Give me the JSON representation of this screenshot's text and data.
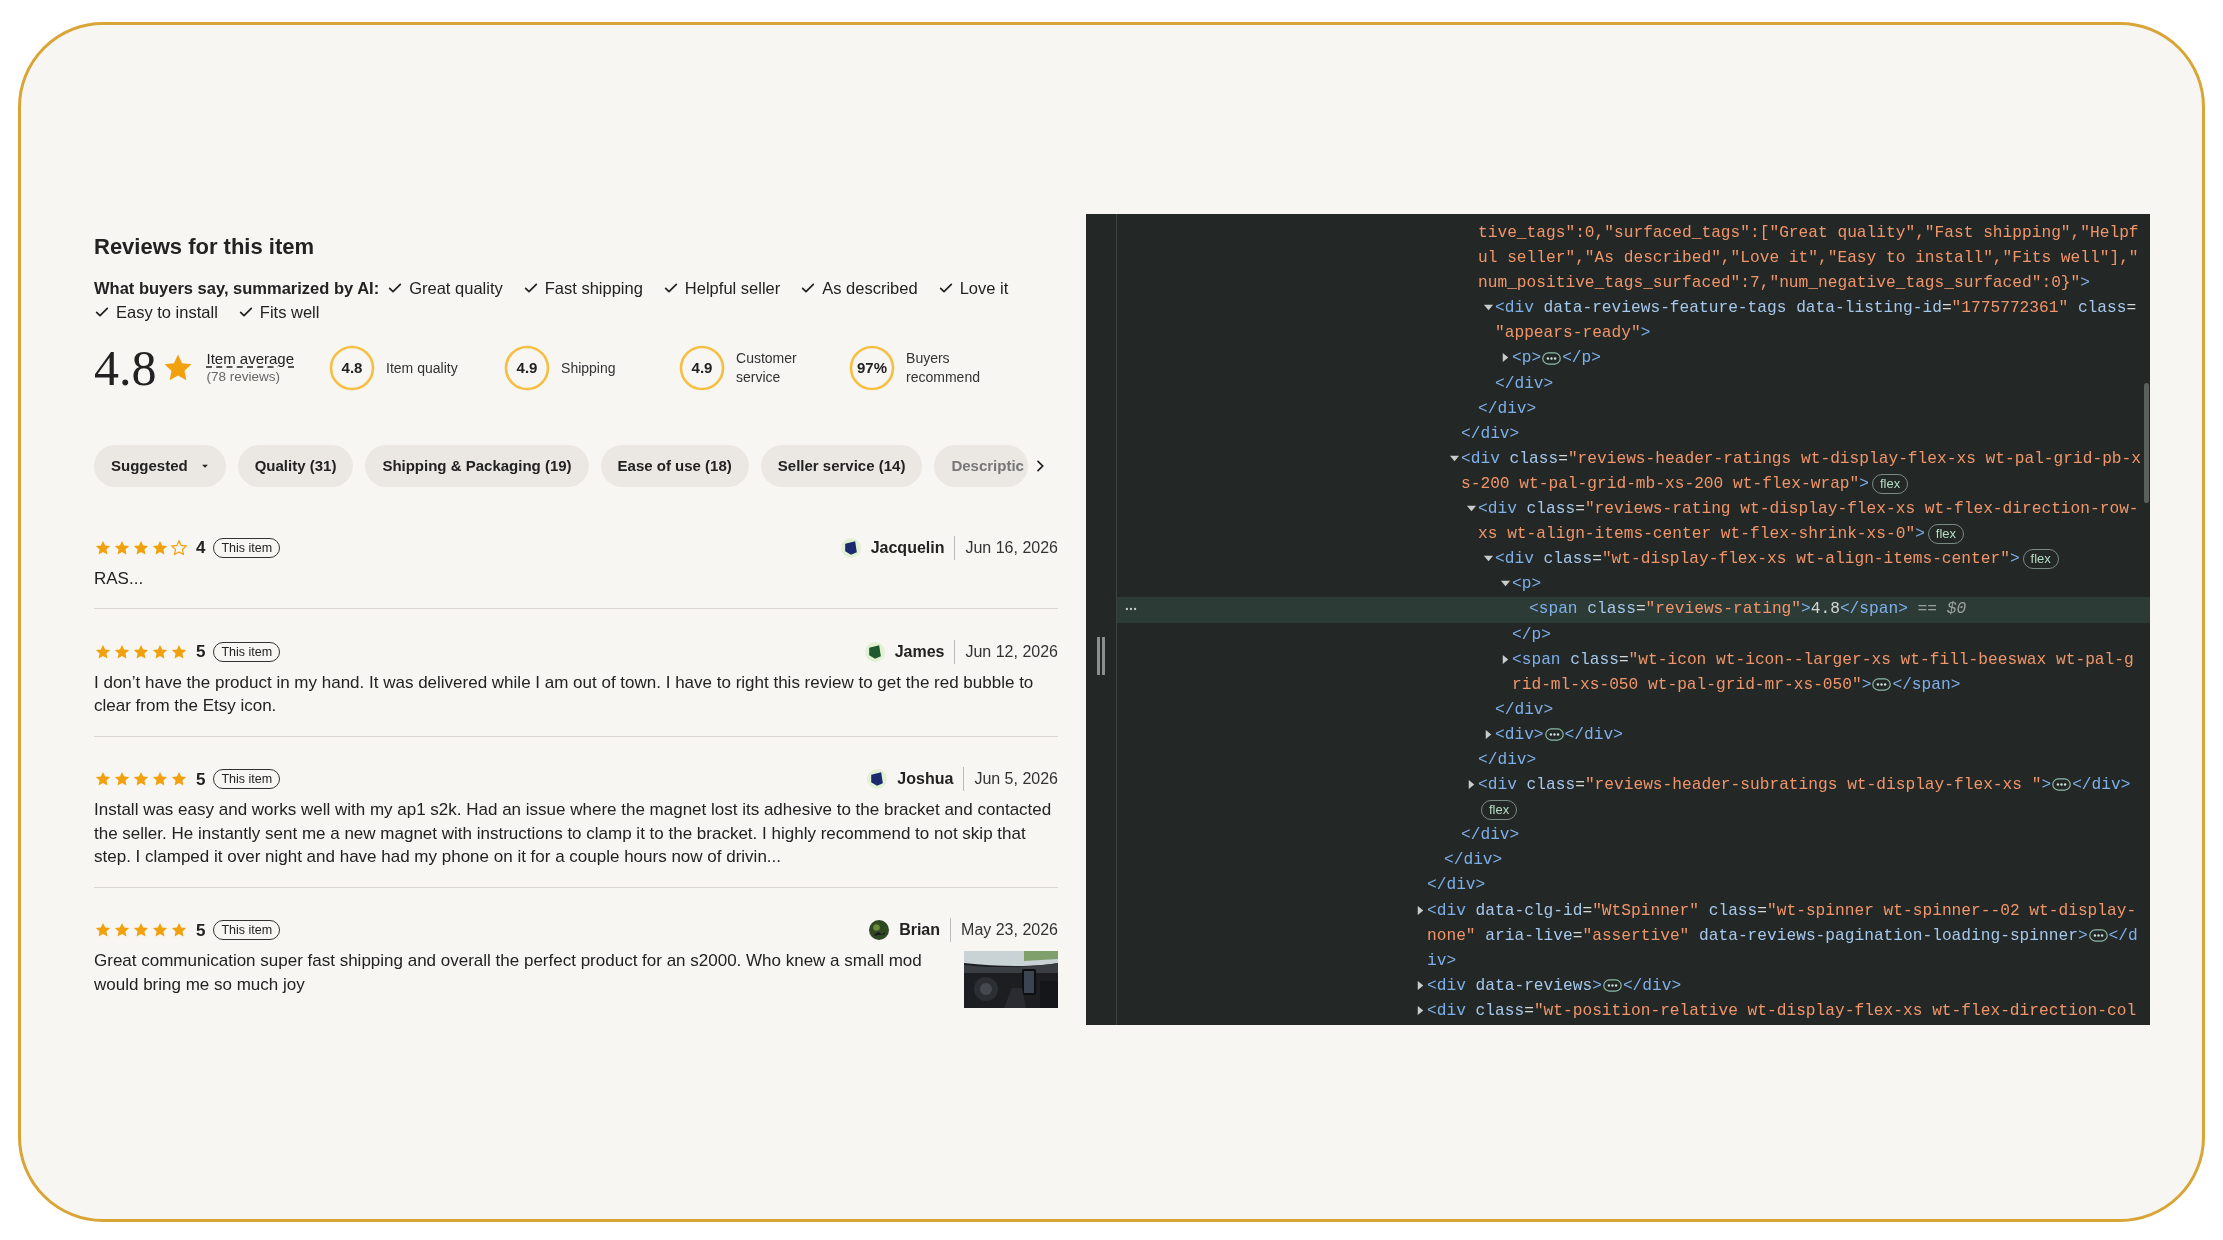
{
  "reviews_panel": {
    "title": "Reviews for this item",
    "ai_summary": {
      "label": "What buyers say, summarized by AI:",
      "tags": [
        "Great quality",
        "Fast shipping",
        "Helpful seller",
        "As described",
        "Love it",
        "Easy to install",
        "Fits well"
      ]
    },
    "rating": {
      "value": "4.8",
      "average_label": "Item average",
      "count": "(78 reviews)"
    },
    "subratings": [
      {
        "value": "4.8",
        "label": "Item quality"
      },
      {
        "value": "4.9",
        "label": "Shipping"
      },
      {
        "value": "4.9",
        "label": "Customer service"
      },
      {
        "value": "97%",
        "label": "Buyers recommend"
      }
    ],
    "filters": [
      {
        "label": "Suggested",
        "kind": "dropdown"
      },
      {
        "label": "Quality (31)",
        "kind": "chip"
      },
      {
        "label": "Shipping & Packaging (19)",
        "kind": "chip"
      },
      {
        "label": "Ease of use (18)",
        "kind": "chip"
      },
      {
        "label": "Seller service (14)",
        "kind": "chip"
      },
      {
        "label": "Descriptic",
        "kind": "faded"
      }
    ],
    "reviews": [
      {
        "stars": 4,
        "score": "4",
        "badge": "This item",
        "author": "Jacquelin",
        "avatar": {
          "kind": "shape",
          "color": "#1b2a6e"
        },
        "date": "Jun 16, 2026",
        "text": "RAS..."
      },
      {
        "stars": 5,
        "score": "5",
        "badge": "This item",
        "author": "James",
        "avatar": {
          "kind": "shape",
          "color": "#1f5a2e"
        },
        "date": "Jun 12, 2026",
        "text": "I don’t have the product in my hand. It was delivered while I am out of town. I have to right this review to get the red bubble to clear from the Etsy icon."
      },
      {
        "stars": 5,
        "score": "5",
        "badge": "This item",
        "author": "Joshua",
        "avatar": {
          "kind": "shape",
          "color": "#1b2a6e"
        },
        "date": "Jun 5, 2026",
        "text": "Install was easy and works well with my ap1 s2k. Had an issue where the magnet lost its adhesive to the bracket and contacted the seller. He instantly sent me a new magnet with instructions to clamp it to the bracket. I highly recommend to not skip that step. I clamped it over night and have had my phone on it for a couple hours now of drivin..."
      },
      {
        "stars": 5,
        "score": "5",
        "badge": "This item",
        "author": "Brian",
        "date": "May 23, 2026",
        "text": "Great communication super fast shipping and overall the perfect product for an s2000. Who knew a small mod would bring me so much joy"
      }
    ]
  },
  "devtools": {
    "nodes": [
      {
        "kind": "offscreen",
        "close": "</div>",
        "children": [
          {
            "kind": "offscreen",
            "close": "</div>",
            "children": [
              {
                "kind": "offscreen",
                "close": "</div>",
                "children": [
                  {
                    "kind": "partial",
                    "selected": false,
                    "open": [
                      {
                        "kind": "value",
                        "text": "tive_tags\":0,\"surfaced_tags\":[\"Great quality\",\"Fast shipping\",\"Helpful seller\",\"As described\",\"Love it\",\"Easy to install\",\"Fits well\"],\"num_positive_tags_surfaced\":7,\"num_negative_tags_surfaced\":0}\""
                      },
                      {
                        "kind": "tag",
                        "text": ">"
                      }
                    ],
                    "close": "</div>",
                    "children": [
                      {
                        "kind": "expanded",
                        "selected": false,
                        "open": [
                          {
                            "kind": "tag",
                            "text": "<div"
                          },
                          {
                            "kind": "attr",
                            "text": " data-reviews-feature-tags"
                          },
                          {
                            "kind": "attr",
                            "text": " data-listing-id"
                          },
                          {
                            "kind": "plain",
                            "text": "="
                          },
                          {
                            "kind": "value",
                            "text": "\"1775772361\""
                          },
                          {
                            "kind": "attr",
                            "text": " class"
                          },
                          {
                            "kind": "plain",
                            "text": "="
                          },
                          {
                            "kind": "value",
                            "text": "\"appears-ready\""
                          },
                          {
                            "kind": "tag",
                            "text": ">"
                          }
                        ],
                        "close": "</div>",
                        "children": [
                          {
                            "kind": "collapsed",
                            "selected": false,
                            "open": [
                              {
                                "kind": "tag",
                                "text": "<p>"
                              }
                            ],
                            "close": "</p>"
                          }
                        ]
                      }
                    ]
                  }
                ]
              },
              {
                "kind": "expanded",
                "selected": false,
                "open": [
                  {
                    "kind": "tag",
                    "text": "<div"
                  },
                  {
                    "kind": "attr",
                    "text": " class"
                  },
                  {
                    "kind": "plain",
                    "text": "="
                  },
                  {
                    "kind": "value",
                    "text": "\"reviews-header-ratings wt-display-flex-xs wt-pal-grid-pb-xs-200 wt-pal-grid-mb-xs-200 wt-flex-wrap\""
                  },
                  {
                    "kind": "tag",
                    "text": ">"
                  }
                ],
                "badge": "flex",
                "close": "</div>",
                "children": [
                  {
                    "kind": "expanded",
                    "selected": false,
                    "open": [
                      {
                        "kind": "tag",
                        "text": "<div"
                      },
                      {
                        "kind": "attr",
                        "text": " class"
                      },
                      {
                        "kind": "plain",
                        "text": "="
                      },
                      {
                        "kind": "value",
                        "text": "\"reviews-rating wt-display-flex-xs wt-flex-direction-row-xs wt-align-items-center wt-flex-shrink-xs-0\""
                      },
                      {
                        "kind": "tag",
                        "text": ">"
                      }
                    ],
                    "badge": "flex",
                    "close": "</div>",
                    "children": [
                      {
                        "kind": "expanded",
                        "selected": false,
                        "open": [
                          {
                            "kind": "tag",
                            "text": "<div"
                          },
                          {
                            "kind": "attr",
                            "text": " class"
                          },
                          {
                            "kind": "plain",
                            "text": "="
                          },
                          {
                            "kind": "value",
                            "text": "\"wt-display-flex-xs wt-align-items-center\""
                          },
                          {
                            "kind": "tag",
                            "text": ">"
                          }
                        ],
                        "badge": "flex",
                        "close": "</div>",
                        "children": [
                          {
                            "kind": "expanded",
                            "selected": false,
                            "open": [
                              {
                                "kind": "tag",
                                "text": "<p>"
                              }
                            ],
                            "close": "</p>",
                            "children": [
                              {
                                "kind": "leaf",
                                "selected": true,
                                "open": [
                                  {
                                    "kind": "tag",
                                    "text": "<span"
                                  },
                                  {
                                    "kind": "attr",
                                    "text": " class"
                                  },
                                  {
                                    "kind": "plain",
                                    "text": "="
                                  },
                                  {
                                    "kind": "value",
                                    "text": "\"reviews-rating\""
                                  },
                                  {
                                    "kind": "tag",
                                    "text": ">"
                                  },
                                  {
                                    "kind": "plain",
                                    "text": "4.8"
                                  },
                                  {
                                    "kind": "tag",
                                    "text": "</span>"
                                  }
                                ],
                                "marker": "== $0"
                              }
                            ]
                          },
                          {
                            "kind": "collapsed",
                            "selected": false,
                            "open": [
                              {
                                "kind": "tag",
                                "text": "<span"
                              },
                              {
                                "kind": "attr",
                                "text": " class"
                              },
                              {
                                "kind": "plain",
                                "text": "="
                              },
                              {
                                "kind": "value",
                                "text": "\"wt-icon wt-icon--larger-xs wt-fill-beeswax wt-pal-grid-ml-xs-050 wt-pal-grid-mr-xs-050\""
                              },
                              {
                                "kind": "tag",
                                "text": ">"
                              }
                            ],
                            "close": "</span>"
                          }
                        ]
                      },
                      {
                        "kind": "collapsed",
                        "selected": false,
                        "open": [
                          {
                            "kind": "tag",
                            "text": "<div>"
                          }
                        ],
                        "close": "</div>"
                      }
                    ]
                  },
                  {
                    "kind": "collapsed",
                    "selected": false,
                    "open": [
                      {
                        "kind": "tag",
                        "text": "<div"
                      },
                      {
                        "kind": "attr",
                        "text": " class"
                      },
                      {
                        "kind": "plain",
                        "text": "="
                      },
                      {
                        "kind": "value",
                        "text": "\"reviews-header-subratings wt-display-flex-xs \""
                      },
                      {
                        "kind": "tag",
                        "text": ">"
                      }
                    ],
                    "close": "</div>",
                    "badge": "flex"
                  }
                ]
              }
            ]
          }
        ]
      },
      {
        "kind": "collapsed",
        "selected": false,
        "open": [
          {
            "kind": "tag",
            "text": "<div"
          },
          {
            "kind": "attr",
            "text": " data-clg-id"
          },
          {
            "kind": "plain",
            "text": "="
          },
          {
            "kind": "value",
            "text": "\"WtSpinner\""
          },
          {
            "kind": "attr",
            "text": " class"
          },
          {
            "kind": "plain",
            "text": "="
          },
          {
            "kind": "value",
            "text": "\"wt-spinner wt-spinner--02 wt-display-none\""
          },
          {
            "kind": "attr",
            "text": " aria-live"
          },
          {
            "kind": "plain",
            "text": "="
          },
          {
            "kind": "value",
            "text": "\"assertive\""
          },
          {
            "kind": "attr",
            "text": " data-reviews-pagination-loading-spinner"
          },
          {
            "kind": "tag",
            "text": ">"
          }
        ],
        "close": "</div>"
      },
      {
        "kind": "collapsed",
        "selected": false,
        "open": [
          {
            "kind": "tag",
            "text": "<div"
          },
          {
            "kind": "attr",
            "text": " data-reviews"
          },
          {
            "kind": "tag",
            "text": ">"
          }
        ],
        "close": "</div>"
      },
      {
        "kind": "cut",
        "selected": false,
        "open": [
          {
            "kind": "tag",
            "text": "<div"
          },
          {
            "kind": "attr",
            "text": " class"
          },
          {
            "kind": "plain",
            "text": "="
          },
          {
            "kind": "value",
            "text": "\"wt-position-relative wt-display-flex-xs wt-flex-direction-col"
          }
        ]
      }
    ]
  }
}
